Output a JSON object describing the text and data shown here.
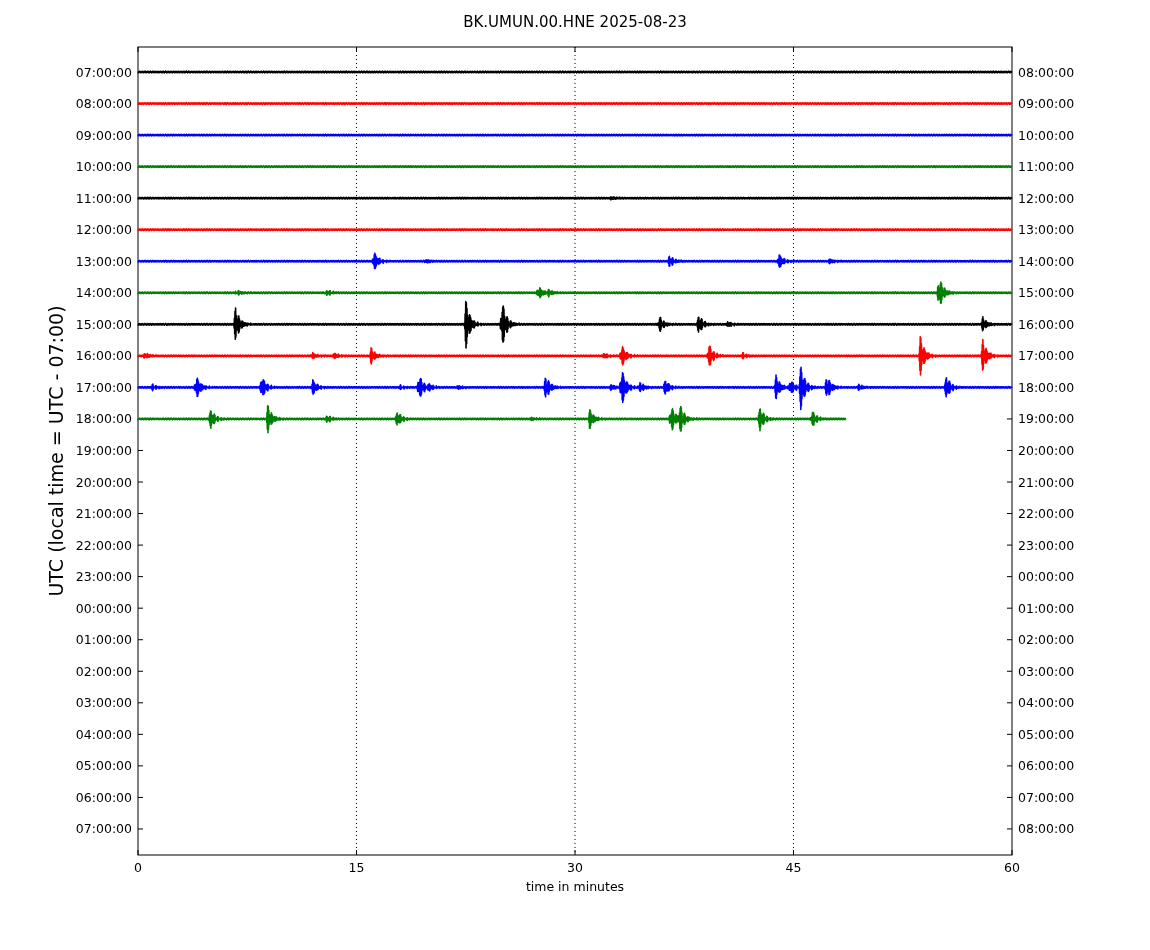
{
  "title": "BK.UMUN.00.HNE 2025-08-23",
  "plot": {
    "ylabel": "UTC (local time = UTC - 07:00)",
    "xlabel": "time in minutes",
    "xticks": [
      "0",
      "15",
      "30",
      "45",
      "60"
    ],
    "rows": [
      {
        "left": "07:00:00",
        "right": "08:00:00",
        "trace": {
          "color": "#000000",
          "level": 1
        }
      },
      {
        "left": "08:00:00",
        "right": "09:00:00",
        "trace": {
          "color": "#ff0000",
          "level": 1
        }
      },
      {
        "left": "09:00:00",
        "right": "10:00:00",
        "trace": {
          "color": "#0000ff",
          "level": 1
        }
      },
      {
        "left": "10:00:00",
        "right": "11:00:00",
        "trace": {
          "color": "#008000",
          "level": 1
        }
      },
      {
        "left": "11:00:00",
        "right": "12:00:00",
        "trace": {
          "color": "#000000",
          "level": 1
        }
      },
      {
        "left": "12:00:00",
        "right": "13:00:00",
        "trace": {
          "color": "#ff0000",
          "level": 1
        }
      },
      {
        "left": "13:00:00",
        "right": "14:00:00",
        "trace": {
          "color": "#0000ff",
          "level": 1
        }
      },
      {
        "left": "14:00:00",
        "right": "15:00:00",
        "trace": {
          "color": "#008000",
          "level": 1
        }
      },
      {
        "left": "15:00:00",
        "right": "16:00:00",
        "trace": {
          "color": "#000000",
          "level": 1
        }
      },
      {
        "left": "16:00:00",
        "right": "17:00:00",
        "trace": {
          "color": "#ff0000",
          "level": 1
        }
      },
      {
        "left": "17:00:00",
        "right": "18:00:00",
        "trace": {
          "color": "#0000ff",
          "level": 1
        }
      },
      {
        "left": "18:00:00",
        "right": "19:00:00",
        "trace": {
          "color": "#008000",
          "level": 0.81
        }
      },
      {
        "left": "19:00:00",
        "right": "20:00:00"
      },
      {
        "left": "20:00:00",
        "right": "21:00:00"
      },
      {
        "left": "21:00:00",
        "right": "22:00:00"
      },
      {
        "left": "22:00:00",
        "right": "23:00:00"
      },
      {
        "left": "23:00:00",
        "right": "00:00:00"
      },
      {
        "left": "00:00:00",
        "right": "01:00:00"
      },
      {
        "left": "01:00:00",
        "right": "02:00:00"
      },
      {
        "left": "02:00:00",
        "right": "03:00:00"
      },
      {
        "left": "03:00:00",
        "right": "04:00:00"
      },
      {
        "left": "04:00:00",
        "right": "05:00:00"
      },
      {
        "left": "05:00:00",
        "right": "06:00:00"
      },
      {
        "left": "06:00:00",
        "right": "07:00:00"
      },
      {
        "left": "07:00:00",
        "right": "08:00:00"
      }
    ]
  }
}
